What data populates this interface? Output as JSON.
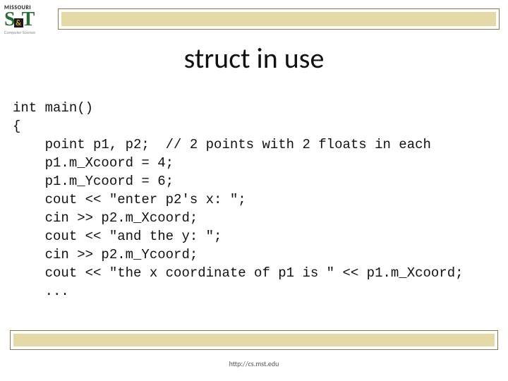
{
  "logo": {
    "top": "MISSOURI",
    "s": "S",
    "amp": "&",
    "t": "T",
    "sub": "Computer Science"
  },
  "title": "struct in use",
  "code_lines": [
    "int main()",
    "{",
    "    point p1, p2;  // 2 points with 2 floats in each",
    "    p1.m_Xcoord = 4;",
    "    p1.m_Ycoord = 6;",
    "    cout << \"enter p2's x: \";",
    "    cin >> p2.m_Xcoord;",
    "    cout << \"and the y: \";",
    "    cin >> p2.m_Ycoord;",
    "    cout << \"the x coordinate of p1 is \" << p1.m_Xcoord;",
    "    ..."
  ],
  "footer": "http://cs.mst.edu"
}
